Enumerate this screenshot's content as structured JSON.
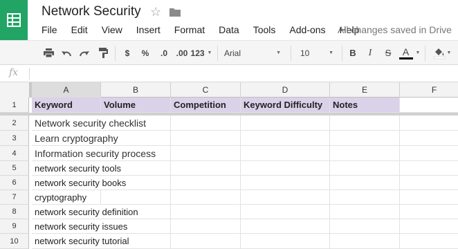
{
  "document": {
    "title": "Network Security",
    "save_status": "All changes saved in Drive"
  },
  "menu": [
    "File",
    "Edit",
    "View",
    "Insert",
    "Format",
    "Data",
    "Tools",
    "Add-ons",
    "Help"
  ],
  "toolbar": {
    "currency": "$",
    "percent": "%",
    "decrease_decimals": ".0",
    "increase_decimals": ".00",
    "more_formats": "123",
    "font_family": "Arial",
    "font_size": "10",
    "bold": "B",
    "italic": "I",
    "strikethrough": "S",
    "text_color": "A",
    "text_color_value": "#000000"
  },
  "formula_bar": {
    "fx_label": "fx",
    "value": ""
  },
  "columns": [
    "A",
    "B",
    "C",
    "D",
    "E",
    "F"
  ],
  "rows": [
    "1",
    "2",
    "3",
    "4",
    "5",
    "6",
    "7",
    "8",
    "9",
    "10"
  ],
  "header_row": [
    "Keyword",
    "Volume",
    "Competition",
    "Keyword Difficulty",
    "Notes"
  ],
  "keywords": [
    "Network security checklist",
    "Learn cryptography",
    "Information security process",
    "network security tools",
    "network security books",
    "cryptography",
    "network security definition",
    "network security issues",
    "network security tutorial"
  ],
  "colors": {
    "brand": "#21a464",
    "header_fill": "#d9d2e9"
  }
}
